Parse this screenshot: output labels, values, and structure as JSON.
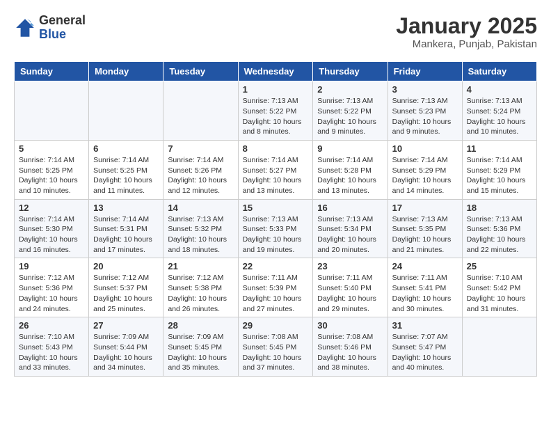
{
  "header": {
    "logo_general": "General",
    "logo_blue": "Blue",
    "month_year": "January 2025",
    "location": "Mankera, Punjab, Pakistan"
  },
  "days_of_week": [
    "Sunday",
    "Monday",
    "Tuesday",
    "Wednesday",
    "Thursday",
    "Friday",
    "Saturday"
  ],
  "weeks": [
    [
      {
        "day": "",
        "info": ""
      },
      {
        "day": "",
        "info": ""
      },
      {
        "day": "",
        "info": ""
      },
      {
        "day": "1",
        "info": "Sunrise: 7:13 AM\nSunset: 5:22 PM\nDaylight: 10 hours and 8 minutes."
      },
      {
        "day": "2",
        "info": "Sunrise: 7:13 AM\nSunset: 5:22 PM\nDaylight: 10 hours and 9 minutes."
      },
      {
        "day": "3",
        "info": "Sunrise: 7:13 AM\nSunset: 5:23 PM\nDaylight: 10 hours and 9 minutes."
      },
      {
        "day": "4",
        "info": "Sunrise: 7:13 AM\nSunset: 5:24 PM\nDaylight: 10 hours and 10 minutes."
      }
    ],
    [
      {
        "day": "5",
        "info": "Sunrise: 7:14 AM\nSunset: 5:25 PM\nDaylight: 10 hours and 10 minutes."
      },
      {
        "day": "6",
        "info": "Sunrise: 7:14 AM\nSunset: 5:25 PM\nDaylight: 10 hours and 11 minutes."
      },
      {
        "day": "7",
        "info": "Sunrise: 7:14 AM\nSunset: 5:26 PM\nDaylight: 10 hours and 12 minutes."
      },
      {
        "day": "8",
        "info": "Sunrise: 7:14 AM\nSunset: 5:27 PM\nDaylight: 10 hours and 13 minutes."
      },
      {
        "day": "9",
        "info": "Sunrise: 7:14 AM\nSunset: 5:28 PM\nDaylight: 10 hours and 13 minutes."
      },
      {
        "day": "10",
        "info": "Sunrise: 7:14 AM\nSunset: 5:29 PM\nDaylight: 10 hours and 14 minutes."
      },
      {
        "day": "11",
        "info": "Sunrise: 7:14 AM\nSunset: 5:29 PM\nDaylight: 10 hours and 15 minutes."
      }
    ],
    [
      {
        "day": "12",
        "info": "Sunrise: 7:14 AM\nSunset: 5:30 PM\nDaylight: 10 hours and 16 minutes."
      },
      {
        "day": "13",
        "info": "Sunrise: 7:14 AM\nSunset: 5:31 PM\nDaylight: 10 hours and 17 minutes."
      },
      {
        "day": "14",
        "info": "Sunrise: 7:13 AM\nSunset: 5:32 PM\nDaylight: 10 hours and 18 minutes."
      },
      {
        "day": "15",
        "info": "Sunrise: 7:13 AM\nSunset: 5:33 PM\nDaylight: 10 hours and 19 minutes."
      },
      {
        "day": "16",
        "info": "Sunrise: 7:13 AM\nSunset: 5:34 PM\nDaylight: 10 hours and 20 minutes."
      },
      {
        "day": "17",
        "info": "Sunrise: 7:13 AM\nSunset: 5:35 PM\nDaylight: 10 hours and 21 minutes."
      },
      {
        "day": "18",
        "info": "Sunrise: 7:13 AM\nSunset: 5:36 PM\nDaylight: 10 hours and 22 minutes."
      }
    ],
    [
      {
        "day": "19",
        "info": "Sunrise: 7:12 AM\nSunset: 5:36 PM\nDaylight: 10 hours and 24 minutes."
      },
      {
        "day": "20",
        "info": "Sunrise: 7:12 AM\nSunset: 5:37 PM\nDaylight: 10 hours and 25 minutes."
      },
      {
        "day": "21",
        "info": "Sunrise: 7:12 AM\nSunset: 5:38 PM\nDaylight: 10 hours and 26 minutes."
      },
      {
        "day": "22",
        "info": "Sunrise: 7:11 AM\nSunset: 5:39 PM\nDaylight: 10 hours and 27 minutes."
      },
      {
        "day": "23",
        "info": "Sunrise: 7:11 AM\nSunset: 5:40 PM\nDaylight: 10 hours and 29 minutes."
      },
      {
        "day": "24",
        "info": "Sunrise: 7:11 AM\nSunset: 5:41 PM\nDaylight: 10 hours and 30 minutes."
      },
      {
        "day": "25",
        "info": "Sunrise: 7:10 AM\nSunset: 5:42 PM\nDaylight: 10 hours and 31 minutes."
      }
    ],
    [
      {
        "day": "26",
        "info": "Sunrise: 7:10 AM\nSunset: 5:43 PM\nDaylight: 10 hours and 33 minutes."
      },
      {
        "day": "27",
        "info": "Sunrise: 7:09 AM\nSunset: 5:44 PM\nDaylight: 10 hours and 34 minutes."
      },
      {
        "day": "28",
        "info": "Sunrise: 7:09 AM\nSunset: 5:45 PM\nDaylight: 10 hours and 35 minutes."
      },
      {
        "day": "29",
        "info": "Sunrise: 7:08 AM\nSunset: 5:45 PM\nDaylight: 10 hours and 37 minutes."
      },
      {
        "day": "30",
        "info": "Sunrise: 7:08 AM\nSunset: 5:46 PM\nDaylight: 10 hours and 38 minutes."
      },
      {
        "day": "31",
        "info": "Sunrise: 7:07 AM\nSunset: 5:47 PM\nDaylight: 10 hours and 40 minutes."
      },
      {
        "day": "",
        "info": ""
      }
    ]
  ]
}
